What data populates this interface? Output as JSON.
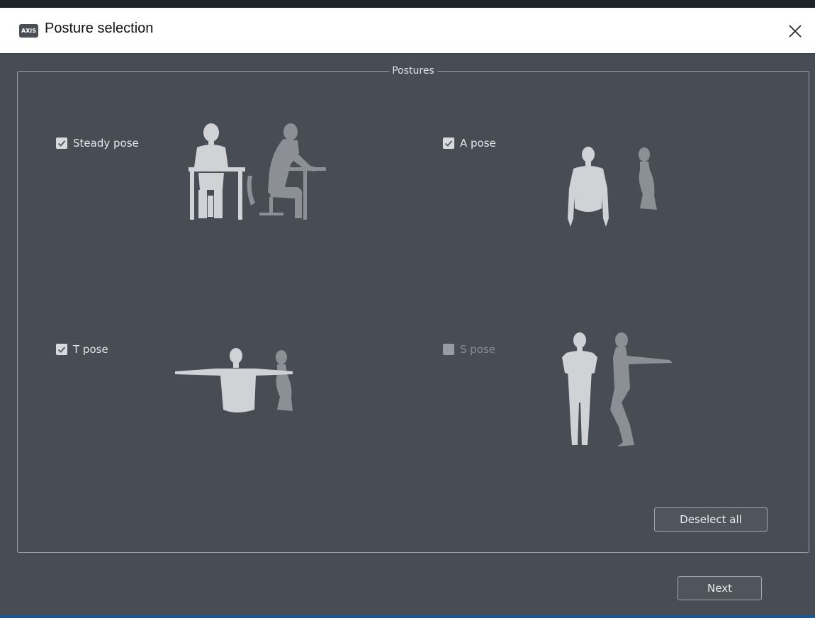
{
  "window": {
    "logo_text": "AXIS",
    "title": "Posture selection"
  },
  "group": {
    "title": "Postures"
  },
  "poses": [
    {
      "label": "Steady pose",
      "checked": true,
      "enabled": true
    },
    {
      "label": "A pose",
      "checked": true,
      "enabled": true
    },
    {
      "label": "T pose",
      "checked": true,
      "enabled": true
    },
    {
      "label": "S pose",
      "checked": false,
      "enabled": false
    }
  ],
  "buttons": {
    "deselect_all": "Deselect all",
    "next": "Next"
  },
  "colors": {
    "background": "#484d55",
    "text": "#e4e6e9",
    "silhouette_front": "#d0d2d6",
    "silhouette_side": "#8c9096"
  }
}
